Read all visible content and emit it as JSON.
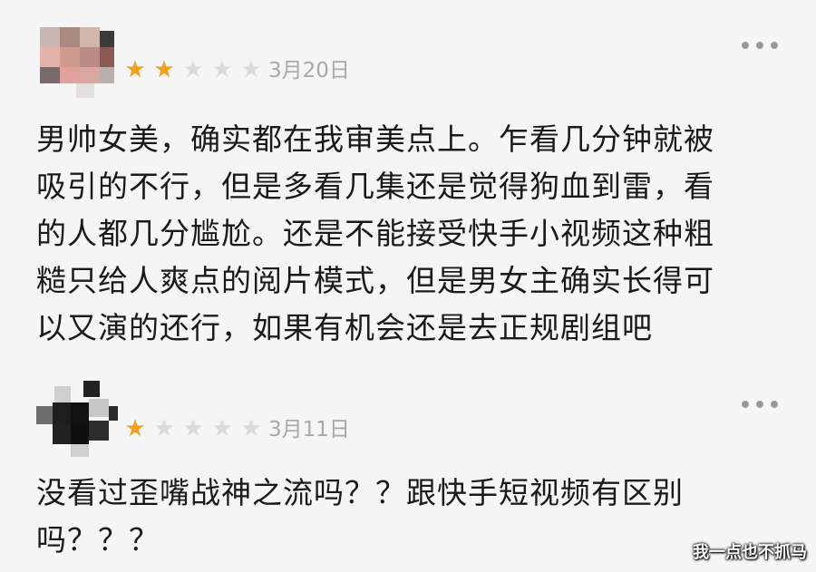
{
  "reviews": [
    {
      "username": "",
      "rating": 2,
      "max_rating": 5,
      "date": "3月20日",
      "text": "男帅女美，确实都在我审美点上。乍看几分钟就被\n吸引的不行，但是多看几集还是觉得狗血到雷，看\n的人都几分尴尬。还是不能接受快手小视频这种粗\n糙只给人爽点的阅片模式，但是男女主确实长得可\n以又演的还行，如果有机会还是去正规剧组吧"
    },
    {
      "username": "",
      "rating": 1,
      "max_rating": 5,
      "date": "3月11日",
      "text": "没看过歪嘴战神之流吗？？跟快手短视频有区别\n吗？？？"
    }
  ],
  "colors": {
    "background": "#f5f5f5",
    "star_on": "#f0a020",
    "star_off": "#dadada",
    "date": "#a8a8a8",
    "text": "#1a1a1a"
  },
  "icons": {
    "star": "★",
    "more": "more-dots-icon",
    "avatar": "pixelated-avatar"
  },
  "watermark": "我一点也不抓马"
}
